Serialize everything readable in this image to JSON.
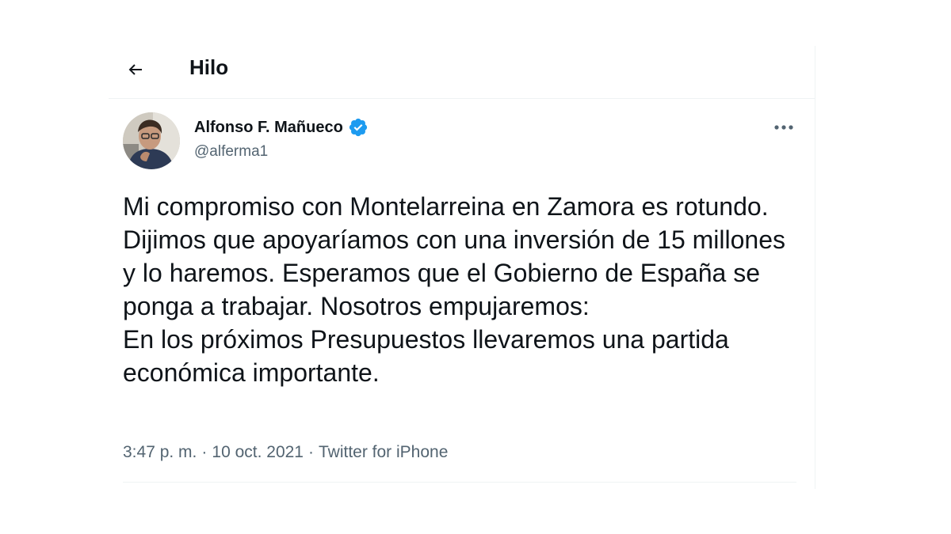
{
  "header": {
    "title": "Hilo",
    "back_icon": "arrow-left-icon"
  },
  "tweet": {
    "author": {
      "name": "Alfonso F. Mañueco",
      "handle": "@alferma1",
      "verified": true,
      "verified_color": "#1d9bf0"
    },
    "text_lines": [
      "Mi compromiso con Montelarreina en Zamora es rotundo. Dijimos que apoyaríamos con una inversión de 15 millones y lo haremos. Esperamos que el Gobierno de España se ponga a trabajar. Nosotros empujaremos:",
      "En los próximos Presupuestos llevaremos una partida económica importante."
    ],
    "time": "3:47 p. m.",
    "date": "10 oct. 2021",
    "source": "Twitter for iPhone",
    "separator": "·"
  },
  "colors": {
    "text_primary": "#0f1419",
    "text_secondary": "#536471",
    "divider": "#eff3f4",
    "accent": "#1d9bf0"
  }
}
